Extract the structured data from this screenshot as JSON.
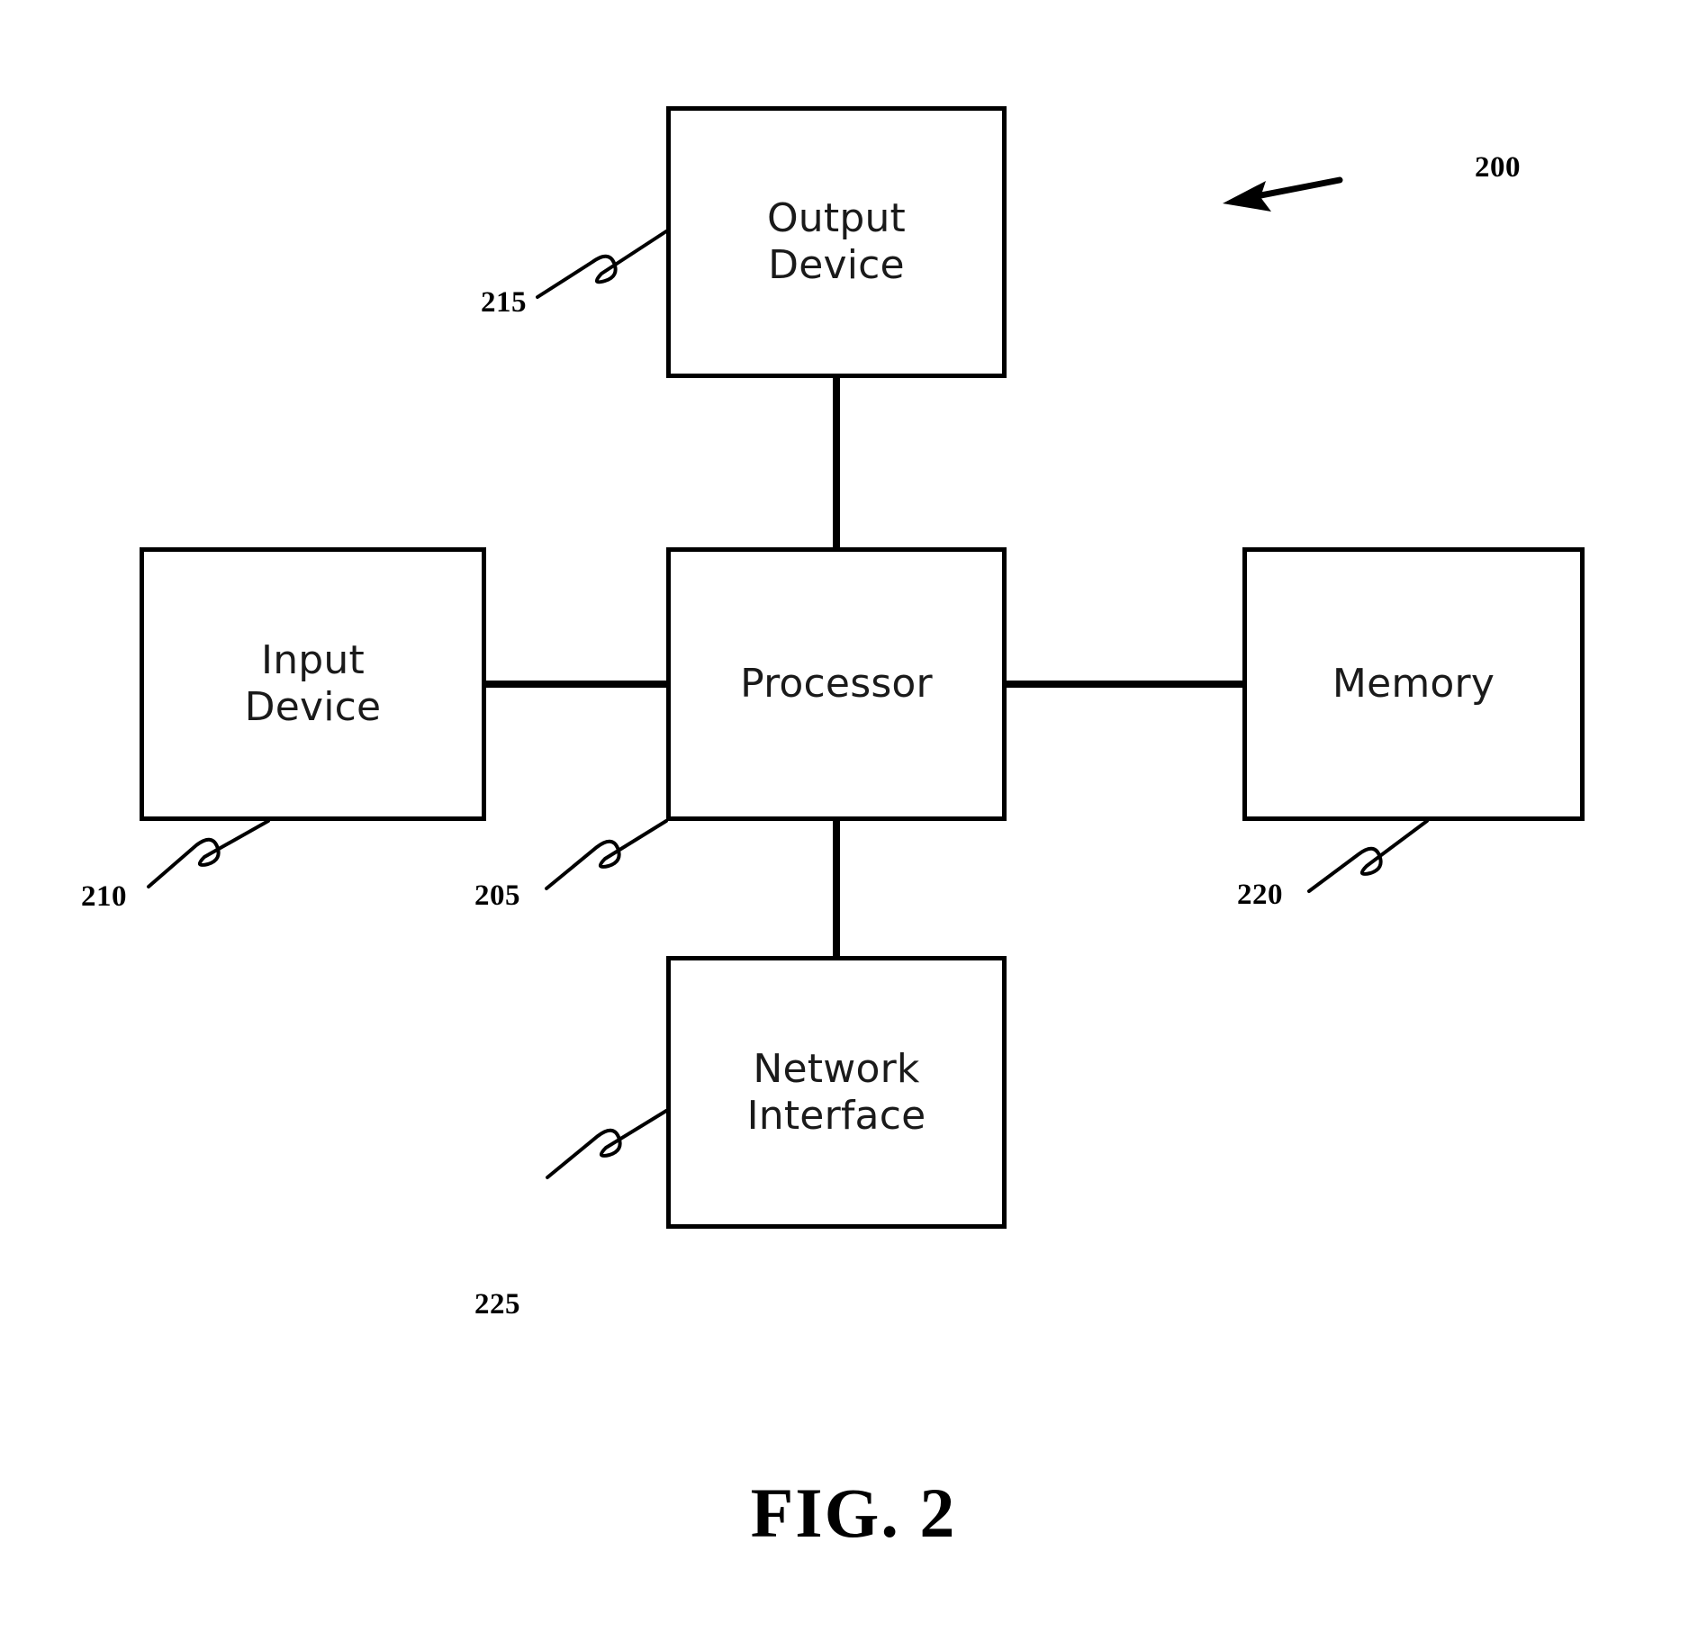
{
  "figure": {
    "caption": "FIG. 2",
    "system_ref": "200"
  },
  "blocks": [
    {
      "id": "output-device",
      "label": "Output\nDevice",
      "ref": "215"
    },
    {
      "id": "input-device",
      "label": "Input\nDevice",
      "ref": "210"
    },
    {
      "id": "processor",
      "label": "Processor",
      "ref": "205"
    },
    {
      "id": "memory",
      "label": "Memory",
      "ref": "220"
    },
    {
      "id": "network-interface",
      "label": "Network\nInterface",
      "ref": "225"
    }
  ],
  "connections": [
    {
      "from": "processor",
      "to": "output-device"
    },
    {
      "from": "input-device",
      "to": "processor"
    },
    {
      "from": "processor",
      "to": "memory"
    },
    {
      "from": "processor",
      "to": "network-interface"
    }
  ],
  "colors": {
    "stroke": "#000000",
    "background": "#ffffff",
    "text": "#1a1a1a"
  }
}
